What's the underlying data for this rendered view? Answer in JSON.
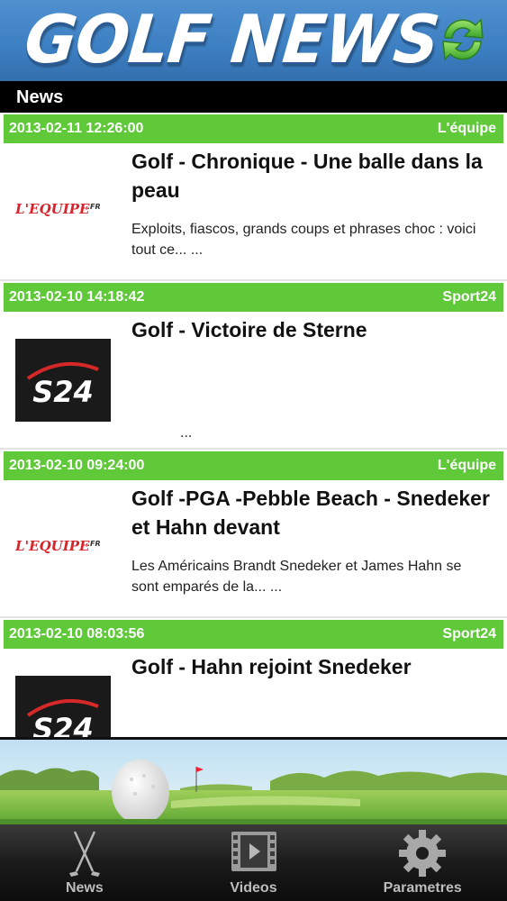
{
  "header": {
    "logo_text": "GOLF NEWS",
    "refresh_icon": "refresh-icon"
  },
  "section": {
    "title": "News"
  },
  "items": [
    {
      "date": "2013-02-11 12:26:00",
      "source": "L'équipe",
      "logo": "lequipe-logo",
      "title": "Golf - Chronique - Une balle dans la peau",
      "summary": "Exploits, fiascos, grands coups et phrases choc  : voici tout ce... ..."
    },
    {
      "date": "2013-02-10 14:18:42",
      "source": "Sport24",
      "logo": "s24-logo",
      "title": "Golf - Victoire de Sterne",
      "summary": "..."
    },
    {
      "date": "2013-02-10 09:24:00",
      "source": "L'équipe",
      "logo": "lequipe-logo",
      "title": "Golf -PGA -Pebble Beach - Snedeker et Hahn devant",
      "summary": "Les Américains Brandt Snedeker et James Hahn se sont emparés de la... ..."
    },
    {
      "date": "2013-02-10 08:03:56",
      "source": "Sport24",
      "logo": "s24-logo",
      "title": "Golf - Hahn rejoint Snedeker",
      "summary": ""
    }
  ],
  "logos": {
    "lequipe": "L'EQUIPE",
    "lequipe_suffix": ".FR",
    "s24": "S24"
  },
  "tabs": [
    {
      "label": "News",
      "icon": "golf-clubs-icon"
    },
    {
      "label": "Videos",
      "icon": "film-icon"
    },
    {
      "label": "Parametres",
      "icon": "gear-icon"
    }
  ],
  "colors": {
    "header_blue": "#3c7fc2",
    "item_green": "#5fc93a",
    "tab_bg": "#1b1b1b"
  }
}
